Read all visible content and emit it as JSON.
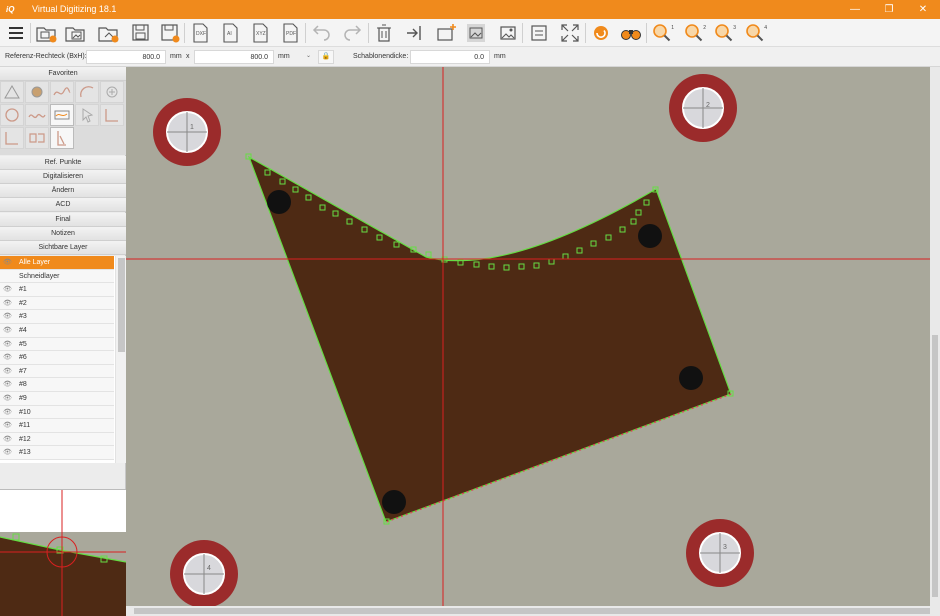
{
  "app": {
    "logo_text": "iQ",
    "title": "Virtual Digitizing 18.1",
    "window_buttons": {
      "minimize": "—",
      "maximize": "❐",
      "close": "✕"
    }
  },
  "toolbar": {
    "items": [
      {
        "icon": "menu-icon"
      },
      {
        "icon": "new-project-icon"
      },
      {
        "icon": "open-image-icon"
      },
      {
        "icon": "open-project-icon"
      },
      {
        "icon": "save-icon"
      },
      {
        "icon": "export-dxf-icon",
        "text": "DXF"
      },
      {
        "icon": "export-ai-icon",
        "text": "AI"
      },
      {
        "icon": "export-xyz-icon",
        "text": "XYZ"
      },
      {
        "icon": "export-pdf-icon",
        "text": "PDF"
      },
      {
        "icon": "undo-icon"
      },
      {
        "icon": "redo-icon"
      },
      {
        "icon": "delete-icon"
      },
      {
        "icon": "cut-icon"
      },
      {
        "icon": "add-frame-icon"
      },
      {
        "icon": "image-settings-icon"
      },
      {
        "icon": "image-edit-icon"
      },
      {
        "icon": "settings-list-icon"
      },
      {
        "icon": "fullscreen-icon"
      },
      {
        "icon": "rotate-icon"
      },
      {
        "icon": "binoculars-icon"
      }
    ],
    "zoom_buttons": [
      {
        "icon": "zoom-icon",
        "sup": "1"
      },
      {
        "icon": "zoom-icon",
        "sup": "2"
      },
      {
        "icon": "zoom-icon",
        "sup": "3"
      },
      {
        "icon": "zoom-icon",
        "sup": "4"
      }
    ]
  },
  "params": {
    "ref_label": "Referenz-Rechteck (BxH):",
    "width_value": "800.0",
    "unit1": "mm",
    "times": "x",
    "height_value": "800.0",
    "unit2": "mm",
    "unit_select": "",
    "thickness_label": "Schablonendicke:",
    "thickness_value": "0.0",
    "unit3": "mm"
  },
  "left": {
    "favorites_label": "Favoriten",
    "sections": [
      "Ref. Punkte",
      "Digitalisieren",
      "Ändern",
      "ACD",
      "Final",
      "Notizen",
      "Sichtbare Layer"
    ],
    "favorite_icons": [
      "measure-icon",
      "fill-icon",
      "curve-icon",
      "arc-icon",
      "point-icon",
      "circle-icon",
      "wave-icon",
      "spline-icon",
      "select-icon",
      "corner-icon",
      "angle-icon",
      "mirror-icon",
      "anchor-icon"
    ],
    "layers": [
      "Alle Layer",
      "Schneidlayer",
      "#1",
      "#2",
      "#3",
      "#4",
      "#5",
      "#6",
      "#7",
      "#8",
      "#9",
      "#10",
      "#11",
      "#12",
      "#13"
    ],
    "selected_layer": "Alle Layer"
  },
  "canvas": {
    "reference_markers": [
      "1",
      "2",
      "3",
      "4"
    ],
    "colors": {
      "background": "#a9a89b",
      "shape": "#4e2a14",
      "outline": "#66dd44",
      "crosshair": "#d92020",
      "marker_ring": "#9b2b2b",
      "accent": "#f08a1c"
    }
  }
}
